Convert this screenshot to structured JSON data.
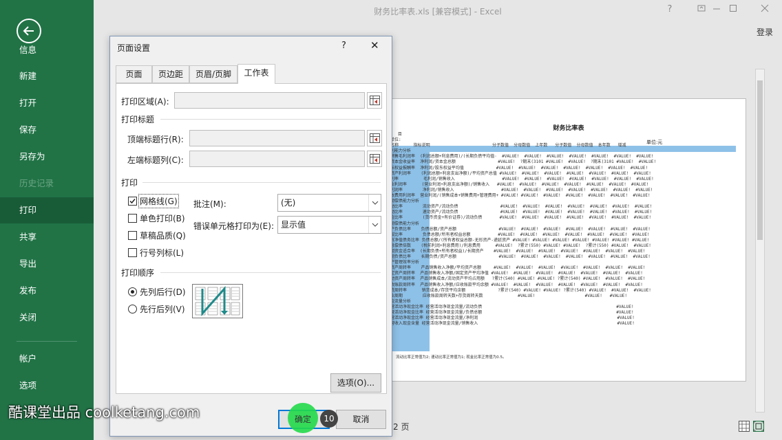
{
  "window": {
    "title": "财务比率表.xls  [兼容模式] - Excel",
    "help": "?",
    "login": "登录"
  },
  "nav": {
    "items": [
      {
        "label": "信息"
      },
      {
        "label": "新建"
      },
      {
        "label": "打开"
      },
      {
        "label": "保存"
      },
      {
        "label": "另存为"
      },
      {
        "label": "历史记录"
      },
      {
        "label": "打印"
      },
      {
        "label": "共享"
      },
      {
        "label": "导出"
      },
      {
        "label": "发布"
      },
      {
        "label": "关闭"
      },
      {
        "label": "帐户"
      },
      {
        "label": "选项"
      }
    ],
    "selected": "打印",
    "disabled": "历史记录",
    "accent_color": "#217346"
  },
  "preview": {
    "sheet_title": "财务比率表",
    "unit": "单位:元",
    "lines": [
      "   目",
      "单位:",
      "名称      指标说明                         分子数值  分母数值  上年数   分子数值  分母数值  本年数   增减",
      "利能力分析",
      "销售毛利润率  (利润总额+利息费用)/(长期负债平均值·  #VALUE!  #VALUE!  #VALUE!  #VALUE!  #VALUE!  #VALUE!  #VALUE!",
      "资本金收益率  净利润/资本金总额                 #VALUE!  ?期末(3101 #VALUE!  #VALUE!  ?期末(3101 #VALUE!  #VALUE!",
      "东权益报酬率  净利润/股东权益平均值             #VALUE!  #VALUE!  #VALUE!  #VALUE!  #VALUE!  #VALUE!  #VALUE!",
      "资产利润率    (利润总额+利息支出净额)/平均资产总值 #VALUE!  #VALUE!  #VALUE!  #VALUE!  #VALUE!  #VALUE!  #VALUE!",
      "利率          毛利润/销售收入                   #VALUE!  #VALUE!  #VALUE!  #VALUE!  #VALUE!  #VALUE!  #VALUE!",
      "业利润率      (营业利润+利息支出净额)/销售收入   #VALUE!  #VALUE!  #VALUE!  #VALUE!  #VALUE!  #VALUE!  #VALUE!",
      "利润率        净利润/销售收入                   #VALUE!  #VALUE!  #VALUE!  #VALUE!  #VALUE!  #VALUE!  #VALUE!",
      "本费用利润率  营业利润/(销售成本+销售费用+管理费用+ #VALUE! #VALUE!  #VALUE!  #VALUE!  #VALUE!  #VALUE!  #VALUE!",
      "期偿债能力分析",
      "动比率        流动资产/流动负债                 #VALUE!  #VALUE!  #VALUE!  #VALUE!  #VALUE!  #VALUE!  #VALUE!",
      "动比率        速动资产/流动负债                 #VALUE!  #VALUE!  #VALUE!  #VALUE!  #VALUE!  #VALUE!  #VALUE!",
      "金比率        (货币资金+有价证券)/流动负债       #VALUE!  #VALUE!  #VALUE!  #VALUE!  #VALUE!  #VALUE!  #VALUE!",
      "",
      "期偿债能力分析",
      "产负债比率    负债总额/资产总额                 #VALUE!  #VALUE!  #VALUE!  #VALUE!  #VALUE!  #VALUE!  #VALUE!",
      "权比率        负债总额/所有者权益总额           #VALUE!  #VALUE!  #VALUE!  #VALUE!  #VALUE!  #VALUE!  #VALUE!",
      "有净值债务比率 负债总额/(所有者权益总额-无形资产-递延资产 #VALUE! #VALUE! #VALUE! #VALUE! #VALUE! #VALUE! #VALUE!",
      "息偿债倍数    (税前利润+利息费用)/利息费用      #VALUE!  ?累计(550) #VALUE! #VALUE!  ?累计(550) #VALUE!  #VALUE!",
      "期资金适合率  (长期负债+所有者权益)/长期资产    #VALUE!  #VALUE!  #VALUE!  #VALUE!  #VALUE!  #VALUE!  #VALUE!",
      "期负债比率    长期负债/资产总额                 #VALUE!  #VALUE!  #VALUE!  #VALUE!  #VALUE!  #VALUE!  #VALUE!",
      "产管理效率分析",
      "资产周转率    产品销售收入净额/平均资产总额     #VALUE!  #VALUE!  #VALUE!  #VALUE!  #VALUE!  #VALUE!  #VALUE!",
      "定资产周转率  产品销售收入净额/固定资产平均净值 #VALUE!  #VALUE!  #VALUE!  #VALUE!  #VALUE!  #VALUE!  #VALUE!",
      "动资产周转率  产品销售成本/流动资产平均占用额   ?累计(540) #VALUE! #VALUE! ?累计(540) #VALUE!  #VALUE!  #VALUE!",
      "收账款周转率  产品销售收入净额/应收账款平均余额 #VALUE!  #VALUE!  #VALUE!  #VALUE!  #VALUE!  #VALUE!  #VALUE!",
      "货周转率      销货成本/存货平均余额             ?累计(540) #VALUE! #VALUE! ?累计(540) #VALUE!  #VALUE!  #VALUE!",
      "业周期        应收账款周转天数+存货周转天数              #VALUE!                    #VALUE!   #VALUE!",
      "金流量分析",
      "营活动净现金比率 经营活动净现金流量/流动负债                                                      #VALUE!",
      "营活动净现金比率 经营活动净现金流量/负债总额                                                      #VALUE!",
      "营活动净现金比率 经营活动净现金流量/净利润                                                        #VALUE!",
      "营收入现金含量 经营活动净现金流量/销售收入                                                        #VALUE!"
    ],
    "note": "流动比率正常值为2; 速动比率正常值为1; 现金比率正常值为0.5。",
    "page_count": "2 页"
  },
  "dialog": {
    "title": "页面设置",
    "help": "?",
    "close": "✕",
    "tabs": [
      {
        "label": "页面"
      },
      {
        "label": "页边距"
      },
      {
        "label": "页眉/页脚"
      },
      {
        "label": "工作表"
      }
    ],
    "active_tab": "工作表",
    "print_area_label": "打印区域(A):",
    "print_area_value": "",
    "print_titles_group": "打印标题",
    "rows_repeat_label": "顶端标题行(R):",
    "rows_repeat_value": "",
    "cols_repeat_label": "左端标题列(C):",
    "cols_repeat_value": "",
    "print_group": "打印",
    "checkboxes": [
      {
        "label": "网格线(G)",
        "checked": true
      },
      {
        "label": "单色打印(B)",
        "checked": false
      },
      {
        "label": "草稿品质(Q)",
        "checked": false
      },
      {
        "label": "行号列标(L)",
        "checked": false
      }
    ],
    "comments_label": "批注(M):",
    "comments_value": "(无)",
    "errors_label": "错误单元格打印为(E):",
    "errors_value": "显示值",
    "order_group": "打印顺序",
    "radios": [
      {
        "label": "先列后行(D)",
        "checked": true
      },
      {
        "label": "先行后列(V)",
        "checked": false
      }
    ],
    "options_button": "选项(O)...",
    "ok_button": "确定",
    "cancel_button": "取消"
  },
  "overlay": {
    "step": "10",
    "watermark": "酷课堂出品 coolketang.com"
  }
}
